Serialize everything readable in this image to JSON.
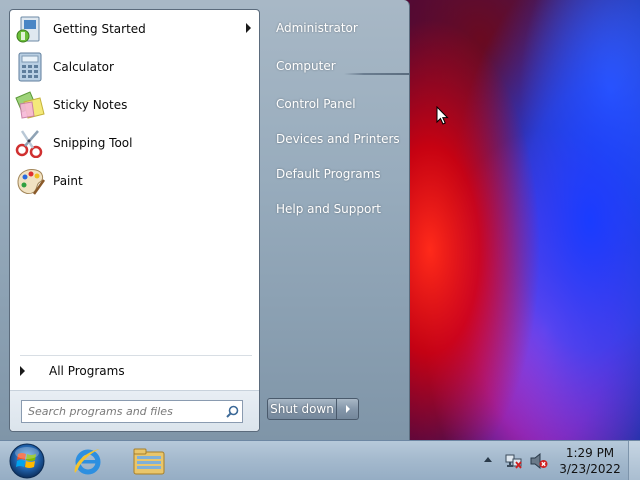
{
  "start_menu": {
    "programs": [
      {
        "label": "Getting Started",
        "icon": "getting-started-icon",
        "has_submenu": true
      },
      {
        "label": "Calculator",
        "icon": "calculator-icon",
        "has_submenu": false
      },
      {
        "label": "Sticky Notes",
        "icon": "sticky-notes-icon",
        "has_submenu": false
      },
      {
        "label": "Snipping Tool",
        "icon": "snipping-tool-icon",
        "has_submenu": false
      },
      {
        "label": "Paint",
        "icon": "paint-icon",
        "has_submenu": false
      }
    ],
    "all_programs_label": "All Programs",
    "search_placeholder": "Search programs and files",
    "right_links": [
      "Administrator",
      "Computer",
      "Control Panel",
      "Devices and Printers",
      "Default Programs",
      "Help and Support"
    ],
    "shutdown_label": "Shut down"
  },
  "taskbar": {
    "pinned": [
      "start-orb",
      "internet-explorer-icon",
      "windows-explorer-icon"
    ],
    "tray": {
      "time": "1:29 PM",
      "date": "3/23/2022",
      "icons": [
        "show-hidden-icons-chevron",
        "network-disconnected-icon",
        "volume-muted-icon"
      ]
    }
  },
  "colors": {
    "menu_glass": "#98acbd",
    "taskbar": "#a5bace",
    "desktop_red": "#ff2a1a",
    "desktop_blue": "#1a3cff",
    "desktop_magenta": "#e040d0"
  }
}
